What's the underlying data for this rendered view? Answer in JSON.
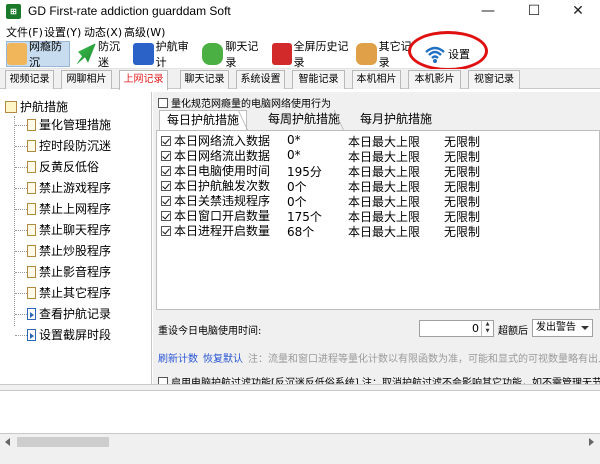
{
  "window": {
    "title": "GD First-rate addiction guarddam Soft",
    "icon_text": "⊞",
    "minimize": "—",
    "maximize": "☐",
    "close": "✕"
  },
  "menu": [
    "文件(F)",
    "设置(Y)",
    "动态(X)",
    "高级(W)"
  ],
  "toolbar": [
    {
      "label": "网瘾防沉",
      "icon": "people-icon",
      "color": "#e8a23a",
      "active": true
    },
    {
      "label": "防沉迷",
      "icon": "arrow-icon",
      "color": "#2aa040"
    },
    {
      "label": "护航审计",
      "icon": "shield-icon",
      "color": "#2a62c8"
    },
    {
      "label": "聊天记录",
      "icon": "chat-icon",
      "color": "#44a53a"
    },
    {
      "label": "全屏历史记录",
      "icon": "camera-icon",
      "color": "#d22a2a"
    },
    {
      "label": "其它记录",
      "icon": "hand-icon",
      "color": "#c0852a"
    },
    {
      "label": "设置",
      "icon": "wifi-icon",
      "color": "#1f6fc2"
    }
  ],
  "tabs": [
    "视频记录",
    "网聊相片",
    "上网记录",
    "聊天记录",
    "系统设置",
    "智能记录",
    "本机相片",
    "本机影片",
    "视窗记录"
  ],
  "selected_tab": "上网记录",
  "tree": {
    "root": "护航措施",
    "items": [
      "量化管理措施",
      "控时段防沉迷",
      "反黄反低俗",
      "禁止游戏程序",
      "禁止上网程序",
      "禁止聊天程序",
      "禁止炒股程序",
      "禁止影音程序",
      "禁止其它程序",
      "查看护航记录",
      "设置截屏时段"
    ]
  },
  "main": {
    "quantify_option": "量化规范网瘾量的电脑网络使用行为",
    "subtabs": [
      "每日护航措施",
      "每周护航措施",
      "每月护航措施"
    ],
    "rows": [
      {
        "name": "本日网络流入数据",
        "value": "0*",
        "limit_label": "本日最大上限",
        "limit": "无限制"
      },
      {
        "name": "本日网络流出数据",
        "value": "0*",
        "limit_label": "本日最大上限",
        "limit": "无限制"
      },
      {
        "name": "本日电脑使用时间",
        "value": "195分",
        "limit_label": "本日最大上限",
        "limit": "无限制"
      },
      {
        "name": "本日护航触发次数",
        "value": "0个",
        "limit_label": "本日最大上限",
        "limit": "无限制"
      },
      {
        "name": "本日关禁违规程序",
        "value": "0个",
        "limit_label": "本日最大上限",
        "limit": "无限制"
      },
      {
        "name": "本日窗口开启数量",
        "value": "175个",
        "limit_label": "本日最大上限",
        "limit": "无限制"
      },
      {
        "name": "本日进程开启数量",
        "value": "68个",
        "limit_label": "本日最大上限",
        "limit": "无限制"
      }
    ],
    "reset_label": "重设今日电脑使用时间:",
    "reset_value": "0",
    "after_label": "超额后",
    "action_select": "发出警告",
    "link_recount": "刷新计数",
    "link_restore": "恢复默认",
    "note": "注：流量和窗口进程等量化计数以有限函数为准，可能和显式的可视数量略有出入",
    "bottom_option": "启用电脑护航过滤功能[反沉迷反低俗系统] 注：取消护航过滤不会影响其它功能，如不需管理无节制的电脑使用"
  }
}
